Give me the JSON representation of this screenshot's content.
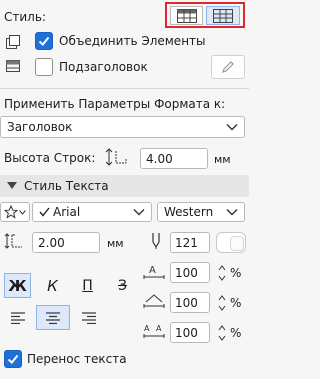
{
  "header": {
    "style_label": "Стиль:"
  },
  "options": {
    "merge_elements": {
      "label": "Объединить Элементы",
      "checked": true
    },
    "subheader": {
      "label": "Подзаголовок",
      "checked": false
    }
  },
  "apply_format": {
    "label": "Применить Параметры Формата к:",
    "selected": "Заголовок"
  },
  "row_height": {
    "label": "Высота Строк:",
    "value": "4.00",
    "unit": "мм"
  },
  "text_style": {
    "title": "Стиль Текста",
    "font": "Arial",
    "script": "Western",
    "size": {
      "value": "2.00",
      "unit": "мм"
    },
    "pen": "121",
    "bold": "Ж",
    "italic": "К",
    "underline": "П",
    "strikethrough": "З",
    "width_pct": "100",
    "spacing_pct": "100",
    "leading_pct": "100",
    "percent_sign": "%",
    "wrap_text": {
      "label": "Перенос текста",
      "checked": true
    }
  },
  "colors": {
    "accent": "#1e6fd8",
    "highlight_border": "#e0262e"
  }
}
